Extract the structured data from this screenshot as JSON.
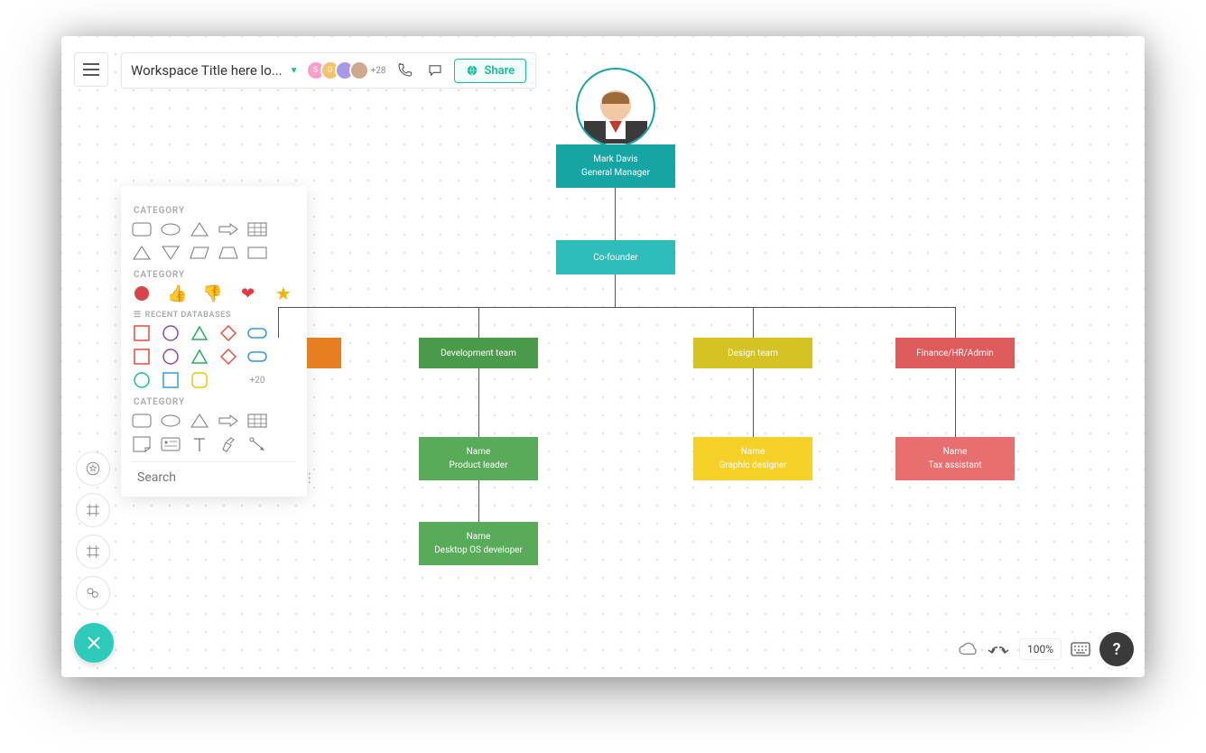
{
  "header": {
    "workspace_title": "Workspace Title here lo...",
    "extra_avatars": "+28",
    "share_label": "Share",
    "avatar_colors": [
      "#ff9dcb",
      "#f7c26b",
      "#a998e6",
      "#cfa98f"
    ],
    "avatar_letters": [
      "S",
      "D",
      "",
      ""
    ]
  },
  "panel": {
    "category_label": "CATEGORY",
    "recent_label": "RECENT DATABASES",
    "more_count": "+20",
    "search_placeholder": "Search"
  },
  "zoom": {
    "level": "100%"
  },
  "chart": {
    "root": {
      "name": "Mark Davis",
      "role": "General Manager",
      "color": "#16a5a5"
    },
    "cofounder": {
      "label": "Co-founder",
      "color": "#2cbdbb"
    },
    "departments": [
      {
        "label": "",
        "color": "#e67e22"
      },
      {
        "label": "Development team",
        "color": "#4b9a4b"
      },
      {
        "label": "Design team",
        "color": "#d4c322"
      },
      {
        "label": "Finance/HR/Admin",
        "color": "#de5b5b"
      }
    ],
    "people": [
      {
        "name": "Name",
        "role": "Product leader",
        "color": "#58ab58"
      },
      {
        "name": "Name",
        "role": "Graphic designer",
        "color": "#f5d027"
      },
      {
        "name": "Name",
        "role": "Tax assistant",
        "color": "#e76f6f"
      },
      {
        "name": "Name",
        "role": "Desktop OS developer",
        "color": "#58ab58"
      }
    ]
  },
  "colors": {
    "teal": "#1abc9c"
  }
}
